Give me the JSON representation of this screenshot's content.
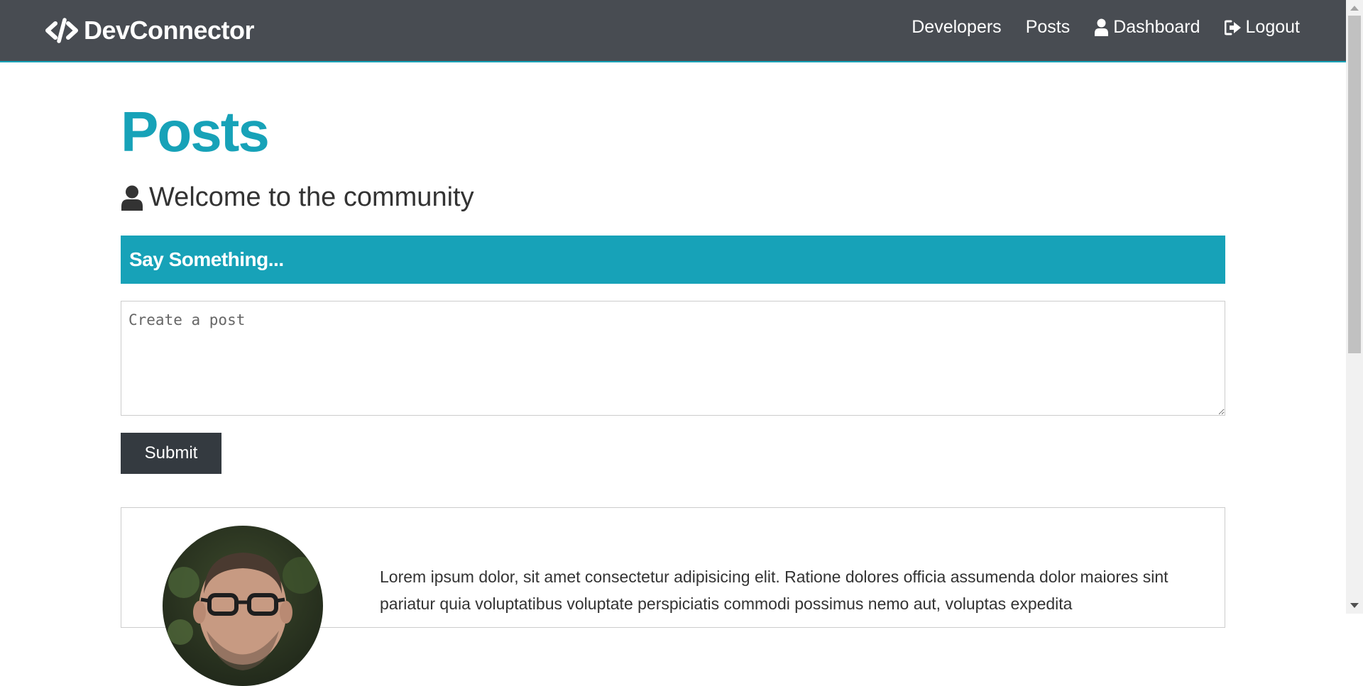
{
  "navbar": {
    "brand": "DevConnector",
    "links": [
      {
        "label": "Developers"
      },
      {
        "label": "Posts"
      },
      {
        "label": "Dashboard"
      },
      {
        "label": "Logout"
      }
    ]
  },
  "page": {
    "title": "Posts",
    "lead": "Welcome to the community"
  },
  "post_form": {
    "header": "Say Something...",
    "textarea_placeholder": "Create a post",
    "textarea_value": "",
    "submit_label": "Submit"
  },
  "posts": [
    {
      "text": "Lorem ipsum dolor, sit amet consectetur adipisicing elit. Ratione dolores officia assumenda dolor maiores sint pariatur quia voluptatibus voluptate perspiciatis commodi possimus nemo aut, voluptas expedita"
    }
  ],
  "colors": {
    "primary": "#17a2b8",
    "dark": "#343a40",
    "navbar": "#484c52"
  },
  "icons": {
    "brand": "code-icon",
    "dashboard": "user-icon",
    "logout": "sign-out-icon",
    "lead": "user-icon"
  }
}
